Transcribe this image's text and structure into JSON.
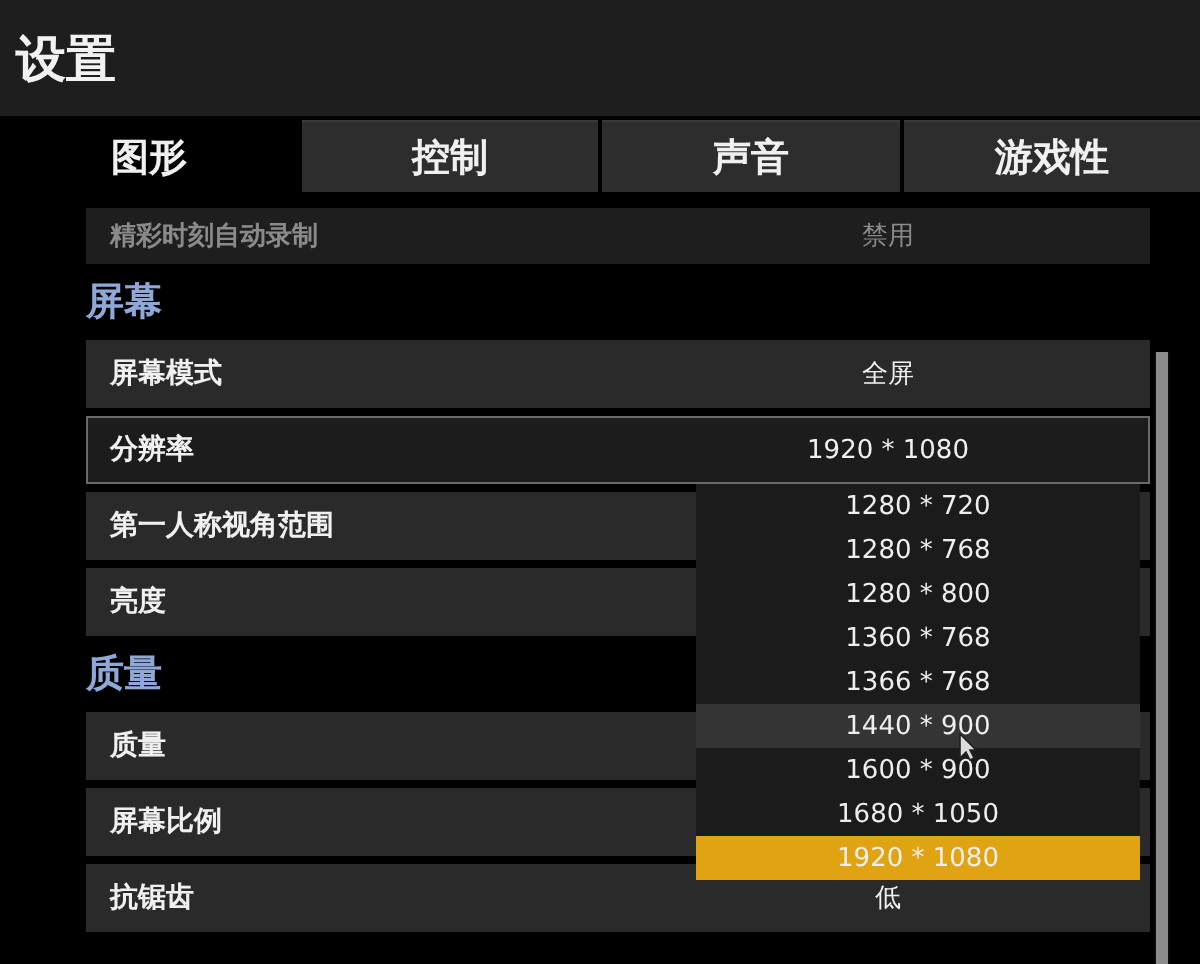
{
  "window": {
    "title": "设置"
  },
  "tabs": [
    {
      "label": "图形",
      "selected": true
    },
    {
      "label": "控制",
      "selected": false
    },
    {
      "label": "声音",
      "selected": false
    },
    {
      "label": "游戏性",
      "selected": false
    }
  ],
  "settings": [
    {
      "kind": "row",
      "label": "精彩时刻自动录制",
      "value": "禁用",
      "disabled": true,
      "focused": false
    },
    {
      "kind": "section",
      "label": "屏幕"
    },
    {
      "kind": "row",
      "label": "屏幕模式",
      "value": "全屏",
      "disabled": false,
      "focused": false
    },
    {
      "kind": "row",
      "label": "分辨率",
      "value": "1920 * 1080",
      "disabled": false,
      "focused": true,
      "dropdown": {
        "options": [
          {
            "label": "1280 * 720",
            "selected": false,
            "hovered": false
          },
          {
            "label": "1280 * 768",
            "selected": false,
            "hovered": false
          },
          {
            "label": "1280 * 800",
            "selected": false,
            "hovered": false
          },
          {
            "label": "1360 * 768",
            "selected": false,
            "hovered": false
          },
          {
            "label": "1366 * 768",
            "selected": false,
            "hovered": false
          },
          {
            "label": "1440 * 900",
            "selected": false,
            "hovered": true
          },
          {
            "label": "1600 * 900",
            "selected": false,
            "hovered": false
          },
          {
            "label": "1680 * 1050",
            "selected": false,
            "hovered": false
          },
          {
            "label": "1920 * 1080",
            "selected": true,
            "hovered": false
          }
        ]
      }
    },
    {
      "kind": "row",
      "label": "第一人称视角范围",
      "disabled": false,
      "focused": false
    },
    {
      "kind": "row",
      "label": "亮度",
      "disabled": false,
      "focused": false
    },
    {
      "kind": "section",
      "label": "质量"
    },
    {
      "kind": "row",
      "label": "质量",
      "disabled": false,
      "focused": false
    },
    {
      "kind": "row",
      "label": "屏幕比例",
      "disabled": false,
      "focused": false
    },
    {
      "kind": "row",
      "label": "抗锯齿",
      "value": "低",
      "disabled": false,
      "focused": false
    }
  ]
}
